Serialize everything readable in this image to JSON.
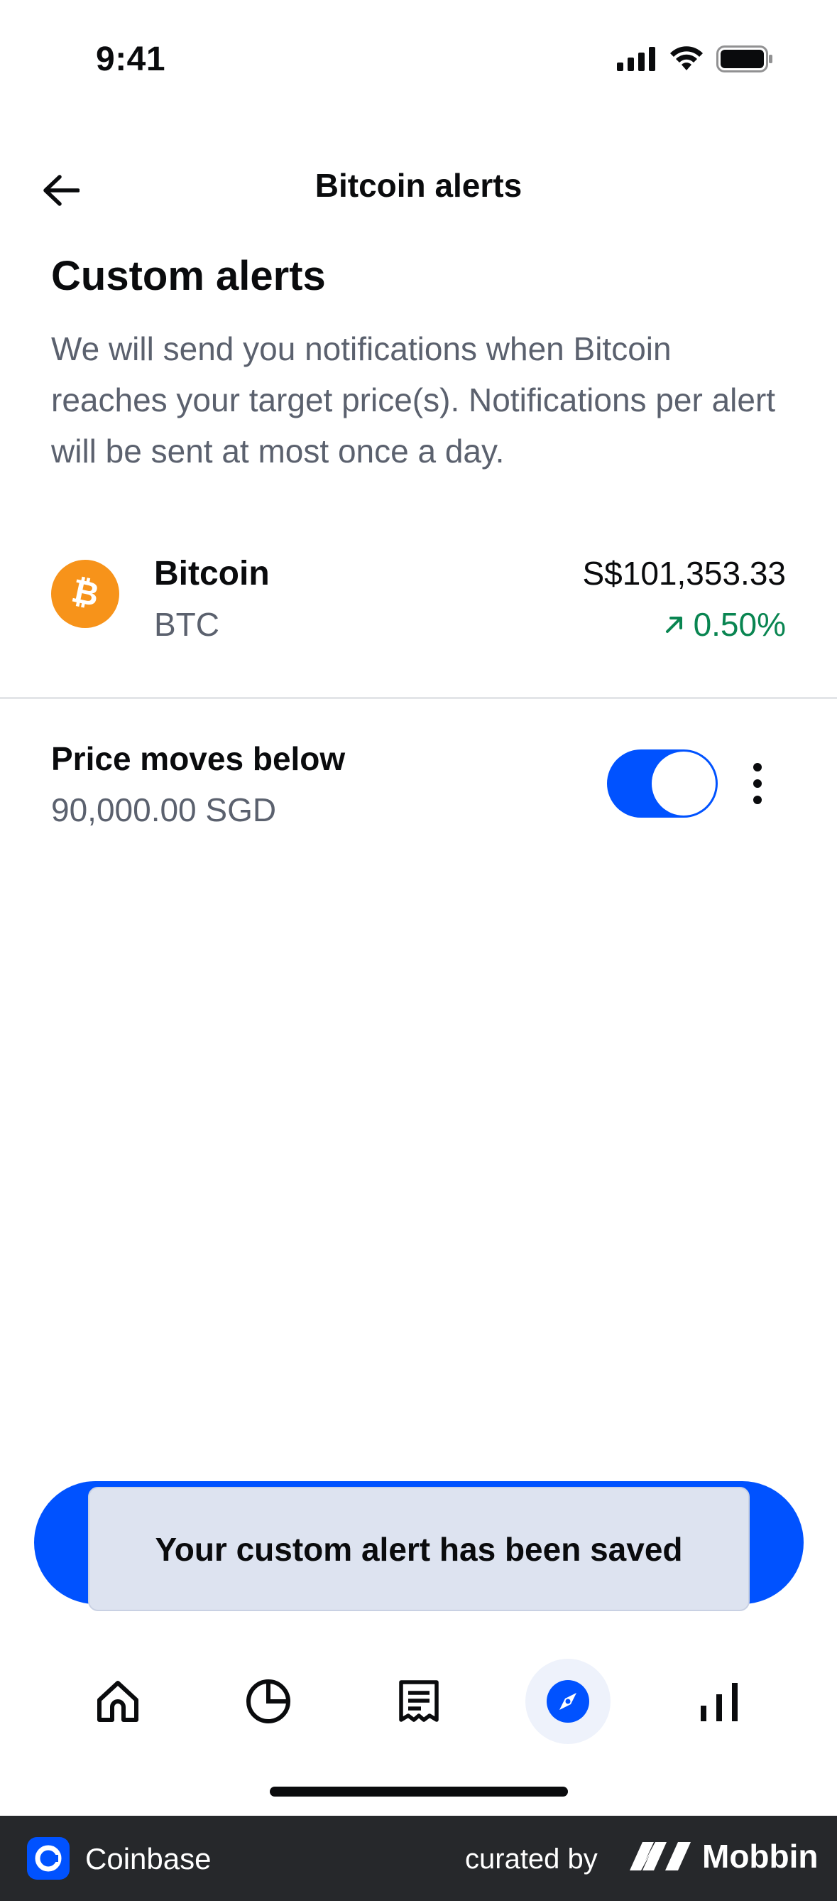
{
  "status_bar": {
    "time": "9:41"
  },
  "header": {
    "title": "Bitcoin alerts"
  },
  "section": {
    "title": "Custom alerts",
    "description": "We will send you notifications when Bitcoin reaches your target price(s). Notifications per alert will be sent at most once a day."
  },
  "asset": {
    "name": "Bitcoin",
    "ticker": "BTC",
    "price": "S$101,353.33",
    "change": "0.50%",
    "change_color": "#098551",
    "logo_color": "#f7931a"
  },
  "alert": {
    "title": "Price moves below",
    "value": "90,000.00 SGD",
    "enabled": true
  },
  "toast": {
    "message": "Your custom alert has been saved"
  },
  "tabs": [
    {
      "name": "home-icon"
    },
    {
      "name": "portfolio-icon"
    },
    {
      "name": "transactions-icon"
    },
    {
      "name": "explore-icon",
      "active": true
    },
    {
      "name": "markets-icon"
    }
  ],
  "footer": {
    "app_name": "Coinbase",
    "curated_label": "curated by",
    "brand": "Mobbin"
  },
  "colors": {
    "accent": "#0052ff",
    "text": "#0a0b0d",
    "muted": "#5b616e"
  }
}
